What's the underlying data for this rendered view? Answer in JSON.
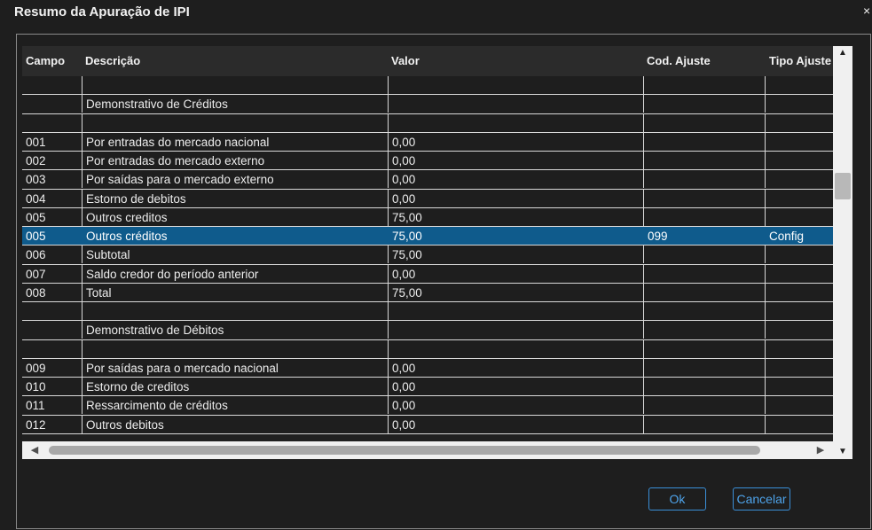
{
  "window": {
    "title": "Resumo da Apuração de IPI",
    "close_label": "×"
  },
  "grid": {
    "columns": [
      "Campo",
      "Descrição",
      "Valor",
      "Cod. Ajuste",
      "Tipo Ajuste"
    ],
    "rows": [
      {
        "campo": "",
        "desc": "",
        "valor": "",
        "cod": "",
        "tipo": ""
      },
      {
        "campo": "",
        "desc": "Demonstrativo de Créditos",
        "valor": "",
        "cod": "",
        "tipo": ""
      },
      {
        "campo": "",
        "desc": "",
        "valor": "",
        "cod": "",
        "tipo": ""
      },
      {
        "campo": "001",
        "desc": "Por entradas do mercado nacional",
        "valor": "0,00",
        "cod": "",
        "tipo": ""
      },
      {
        "campo": "002",
        "desc": "Por entradas do mercado externo",
        "valor": "0,00",
        "cod": "",
        "tipo": ""
      },
      {
        "campo": "003",
        "desc": "Por saídas para o mercado externo",
        "valor": "0,00",
        "cod": "",
        "tipo": ""
      },
      {
        "campo": "004",
        "desc": "Estorno de debitos",
        "valor": "0,00",
        "cod": "",
        "tipo": ""
      },
      {
        "campo": "005",
        "desc": "Outros creditos",
        "valor": "75,00",
        "cod": "",
        "tipo": ""
      },
      {
        "campo": "005",
        "desc": "Outros créditos",
        "valor": "75,00",
        "cod": "099",
        "tipo": "Config",
        "selected": true
      },
      {
        "campo": "006",
        "desc": "Subtotal",
        "valor": "75,00",
        "cod": "",
        "tipo": ""
      },
      {
        "campo": "007",
        "desc": "Saldo credor do período anterior",
        "valor": "0,00",
        "cod": "",
        "tipo": ""
      },
      {
        "campo": "008",
        "desc": "Total",
        "valor": "75,00",
        "cod": "",
        "tipo": ""
      },
      {
        "campo": "",
        "desc": "",
        "valor": "",
        "cod": "",
        "tipo": ""
      },
      {
        "campo": "",
        "desc": "Demonstrativo de Débitos",
        "valor": "",
        "cod": "",
        "tipo": ""
      },
      {
        "campo": "",
        "desc": "",
        "valor": "",
        "cod": "",
        "tipo": ""
      },
      {
        "campo": "009",
        "desc": "Por saídas para o mercado nacional",
        "valor": "0,00",
        "cod": "",
        "tipo": ""
      },
      {
        "campo": "010",
        "desc": "Estorno de creditos",
        "valor": "0,00",
        "cod": "",
        "tipo": ""
      },
      {
        "campo": "011",
        "desc": "Ressarcimento de créditos",
        "valor": "0,00",
        "cod": "",
        "tipo": ""
      },
      {
        "campo": "012",
        "desc": "Outros debitos",
        "valor": "0,00",
        "cod": "",
        "tipo": ""
      }
    ]
  },
  "icons": {
    "scroll_up": "▲",
    "scroll_down": "▼",
    "scroll_left": "◀",
    "scroll_right": "▶"
  },
  "buttons": {
    "ok": "Ok",
    "cancel": "Cancelar"
  },
  "colors": {
    "selected_row": "#0f5b8c",
    "button_accent": "#3a8fd8"
  }
}
